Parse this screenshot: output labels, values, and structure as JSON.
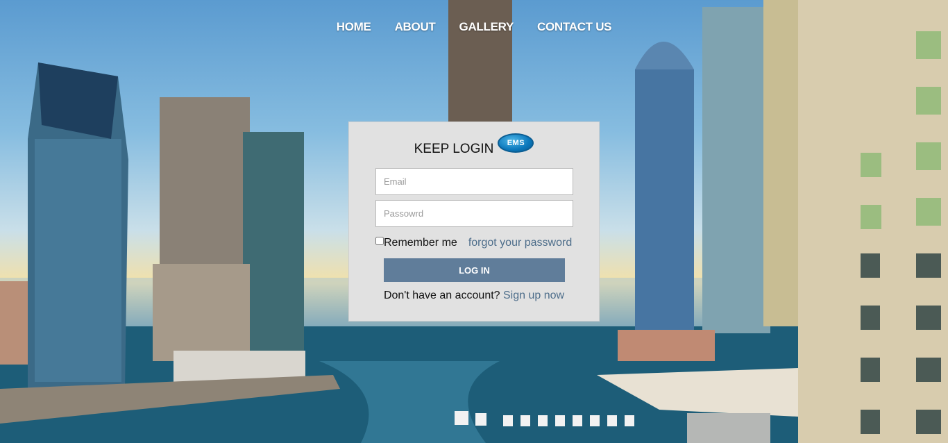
{
  "nav": {
    "items": [
      {
        "label": "HOME"
      },
      {
        "label": "ABOUT"
      },
      {
        "label": "GALLERY"
      },
      {
        "label": "CONTACT US"
      }
    ]
  },
  "login": {
    "title": "KEEP LOGIN",
    "logo_text": "EMS",
    "email_placeholder": "Email",
    "password_placeholder": "Passowrd",
    "remember_label": "Remember me",
    "forgot_label": "forgot your password",
    "submit_label": "LOG IN",
    "signup_prompt": "Don't have an account?",
    "signup_link": "Sign up now"
  },
  "colors": {
    "panel_bg": "#e1e1e1",
    "button_bg": "#607d9a",
    "link": "#4d6d8a",
    "logo_blue": "#0a77bb"
  }
}
